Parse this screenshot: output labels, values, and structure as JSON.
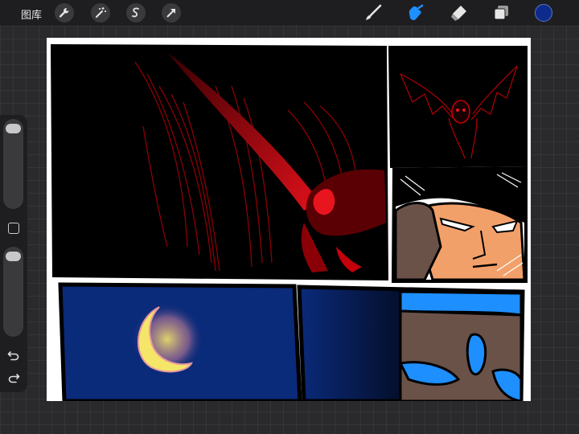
{
  "topbar": {
    "gallery_label": "图库",
    "left_tools": [
      "wrench-icon",
      "magic-wand-icon",
      "selection-icon",
      "transform-arrow-icon"
    ],
    "right_tools": [
      "brush-icon",
      "smudge-icon",
      "eraser-icon",
      "layers-icon"
    ],
    "active_tool": "smudge",
    "active_color": "#0e2a8a",
    "accent_color": "#1e8fff"
  },
  "sidebar": {
    "brush_size_level": 0,
    "opacity_level": 0,
    "icons": [
      "modify-square-icon",
      "undo-icon",
      "redo-icon"
    ]
  },
  "canvas": {
    "panels": [
      "panel-wings-closeup",
      "panel-bat-creature",
      "panel-hero-face",
      "panel-crescent-moon",
      "panel-armored-figure"
    ],
    "colors": {
      "ink": "#000000",
      "blood_red": "#c4000a",
      "night_blue": "#0a2a7a",
      "moon": "#f5e66a",
      "skin": "#f2a06a",
      "coat": "#6a5248",
      "armor_blue": "#1e8fff"
    }
  }
}
